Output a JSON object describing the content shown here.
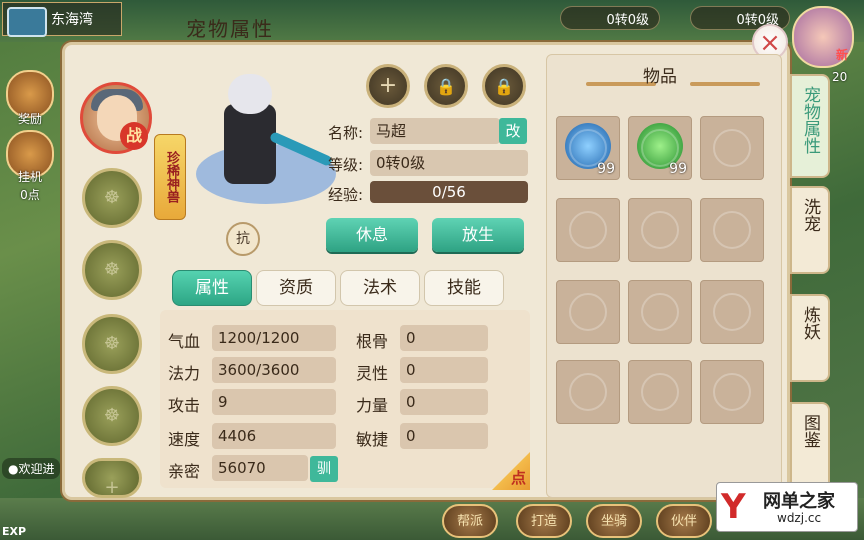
{
  "header": {
    "map_name": "东海湾",
    "chips": [
      "0转0级",
      "0转0级"
    ]
  },
  "left_sidebar": {
    "labels": [
      "奖励",
      "挂机",
      "0点"
    ],
    "welcome": "●欢迎进",
    "exp_label": "EXP"
  },
  "panel": {
    "title": "宠物属性",
    "close_icon": "×"
  },
  "pet": {
    "rare_tag": "珍稀神兽",
    "war_badge": "战",
    "resist_label": "抗",
    "name_label": "名称:",
    "name_value": "马超",
    "rename_label": "改",
    "level_label": "等级:",
    "level_value": "0转0级",
    "exp_label": "经验:",
    "exp_value": "0/56",
    "rest_button": "休息",
    "release_button": "放生"
  },
  "top_buttons": [
    {
      "icon": "plus-icon",
      "glyph": "+"
    },
    {
      "icon": "lock-icon",
      "glyph": "🔒"
    },
    {
      "icon": "lock-icon",
      "glyph": "🔒"
    }
  ],
  "tabs": [
    "属性",
    "资质",
    "法术",
    "技能"
  ],
  "attributes": {
    "left": [
      {
        "label": "气血",
        "value": "1200/1200"
      },
      {
        "label": "法力",
        "value": "3600/3600"
      },
      {
        "label": "攻击",
        "value": "9"
      },
      {
        "label": "速度",
        "value": "4406"
      },
      {
        "label": "亲密",
        "value": "56070"
      }
    ],
    "right": [
      {
        "label": "根骨",
        "value": "0"
      },
      {
        "label": "灵性",
        "value": "0"
      },
      {
        "label": "力量",
        "value": "0"
      },
      {
        "label": "敏捷",
        "value": "0"
      }
    ],
    "tame_button": "驯",
    "point_badge": "点"
  },
  "inventory": {
    "title": "物品",
    "items": [
      {
        "name": "blue-orb-item",
        "count": "99",
        "color": "#2a8fd6"
      },
      {
        "name": "green-dragon-item",
        "count": "99",
        "color": "#3ab84a"
      }
    ],
    "slot_count": 12
  },
  "side_tabs": [
    "宠物属性",
    "洗宠",
    "炼妖",
    "图鉴"
  ],
  "right_avatar": {
    "new_label": "新",
    "level": "20"
  },
  "bottom_buttons": [
    "帮派",
    "打造",
    "坐骑",
    "伙伴"
  ],
  "watermark": {
    "brand": "网单之家",
    "url": "wdzj.cc",
    "logo": "Y"
  }
}
